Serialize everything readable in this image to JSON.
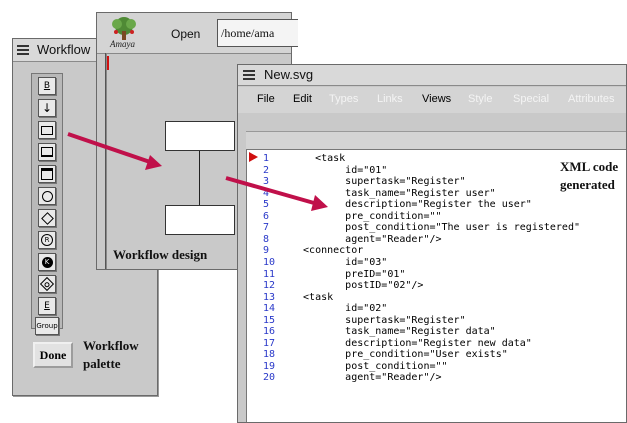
{
  "palette": {
    "title": "Workflow",
    "tools": [
      {
        "icon": "b-button-icon",
        "label": "B"
      },
      {
        "icon": "down-arrow-icon",
        "label": "↓"
      },
      {
        "icon": "rectangle-icon",
        "label": ""
      },
      {
        "icon": "rounded-rectangle-icon",
        "label": ""
      },
      {
        "icon": "double-rectangle-icon",
        "label": ""
      },
      {
        "icon": "circle-icon",
        "label": ""
      },
      {
        "icon": "diamond-icon",
        "label": ""
      },
      {
        "icon": "r-circle-icon",
        "label": "R"
      },
      {
        "icon": "filled-k-circle-icon",
        "label": "K"
      },
      {
        "icon": "diamond-circle-icon",
        "label": ""
      },
      {
        "icon": "e-button-icon",
        "label": "E"
      },
      {
        "icon": "group-button-icon",
        "label": "Group"
      }
    ],
    "done_label": "Done",
    "caption_line1": "Workflow",
    "caption_line2": "palette"
  },
  "design_window": {
    "app_logo_text": "Amaya",
    "open_label": "Open",
    "path_value": "/home/ama",
    "caption": "Workflow design"
  },
  "xml_window": {
    "title": "New.svg",
    "menus": [
      {
        "label": "File",
        "enabled": true
      },
      {
        "label": "Edit",
        "enabled": true
      },
      {
        "label": "Types",
        "enabled": false
      },
      {
        "label": "Links",
        "enabled": false
      },
      {
        "label": "Views",
        "enabled": true
      },
      {
        "label": "Style",
        "enabled": false
      },
      {
        "label": "Special",
        "enabled": false
      },
      {
        "label": "Attributes",
        "enabled": false
      }
    ],
    "caption_line1": "XML code",
    "caption_line2": "generated",
    "lines": [
      {
        "n": "1",
        "text": "    <task"
      },
      {
        "n": "2",
        "text": "         id=\"01\""
      },
      {
        "n": "3",
        "text": "         supertask=\"Register\""
      },
      {
        "n": "4",
        "text": "         task_name=\"Register user\""
      },
      {
        "n": "5",
        "text": "         description=\"Register the user\""
      },
      {
        "n": "6",
        "text": "         pre_condition=\"\""
      },
      {
        "n": "7",
        "text": "         post_condition=\"The user is registered\""
      },
      {
        "n": "8",
        "text": "         agent=\"Reader\"/>"
      },
      {
        "n": "9",
        "text": "  <connector"
      },
      {
        "n": "10",
        "text": "         id=\"03\""
      },
      {
        "n": "11",
        "text": "         preID=\"01\""
      },
      {
        "n": "12",
        "text": "         postID=\"02\"/>"
      },
      {
        "n": "13",
        "text": "  <task"
      },
      {
        "n": "14",
        "text": "         id=\"02\""
      },
      {
        "n": "15",
        "text": "         supertask=\"Register\""
      },
      {
        "n": "16",
        "text": "         task_name=\"Register data\""
      },
      {
        "n": "17",
        "text": "         description=\"Register new data\""
      },
      {
        "n": "18",
        "text": "         pre_condition=\"User exists\""
      },
      {
        "n": "19",
        "text": "         post_condition=\"\""
      },
      {
        "n": "20",
        "text": "         agent=\"Reader\"/>"
      }
    ]
  },
  "colors": {
    "arrow": "#c0104a",
    "line_numbers": "#2a39c9",
    "window_bg": "#c9c9c9",
    "marker": "#d01010"
  }
}
